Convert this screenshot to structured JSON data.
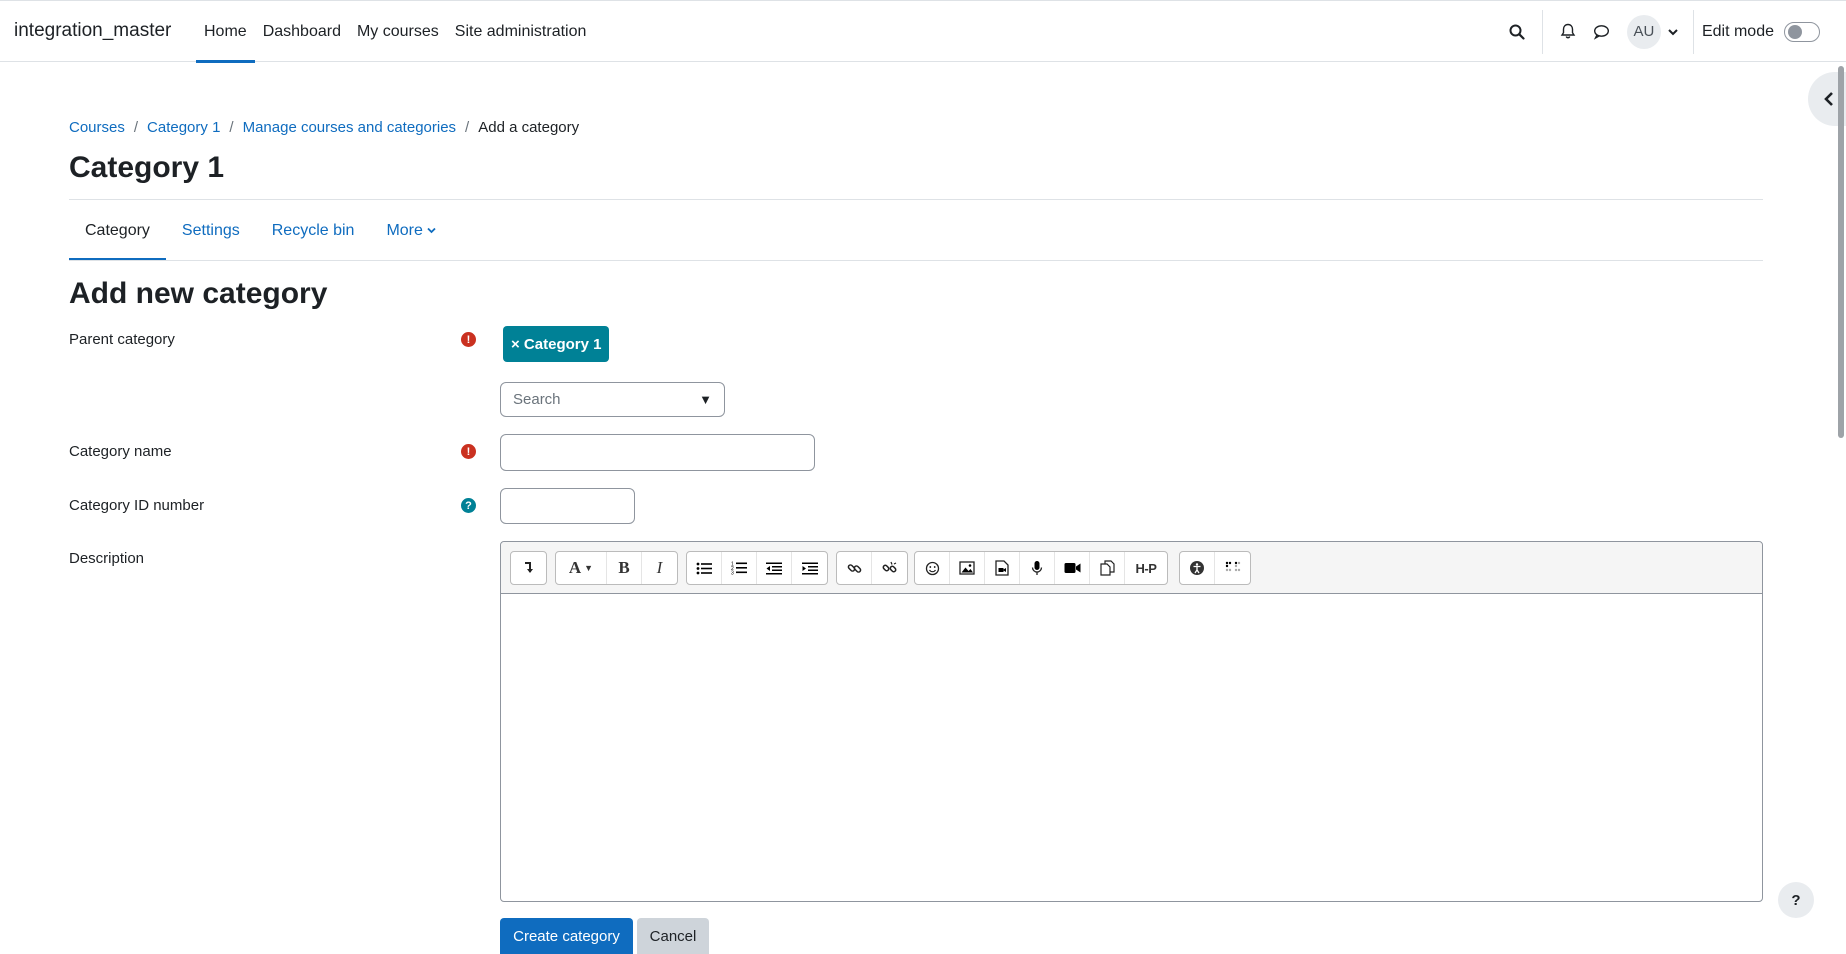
{
  "header": {
    "brand": "integration_master",
    "nav": [
      {
        "label": "Home",
        "active": true
      },
      {
        "label": "Dashboard"
      },
      {
        "label": "My courses"
      },
      {
        "label": "Site administration"
      }
    ],
    "icons": [
      "search-icon",
      "bell-icon",
      "chat-icon"
    ],
    "avatar_initials": "AU",
    "edit_mode_label": "Edit mode",
    "edit_mode_on": false
  },
  "breadcrumb": [
    "Courses",
    "Category 1",
    "Manage courses and categories",
    "Add a category"
  ],
  "page_title": "Category 1",
  "tabs": [
    {
      "label": "Category",
      "active": true
    },
    {
      "label": "Settings"
    },
    {
      "label": "Recycle bin"
    },
    {
      "label": "More"
    }
  ],
  "form": {
    "title": "Add new category",
    "parent_category": {
      "label": "Parent category",
      "selected_chip": "× Category 1",
      "search_placeholder": "Search",
      "required": true
    },
    "category_name": {
      "label": "Category name",
      "value": "",
      "required": true
    },
    "category_id": {
      "label": "Category ID number",
      "value": "",
      "help": true
    },
    "description": {
      "label": "Description",
      "value": ""
    },
    "submit_label": "Create category",
    "cancel_label": "Cancel"
  },
  "help_fab": "?",
  "colors": {
    "link": "#0f6cbf",
    "accent_teal": "#008196",
    "required_red": "#ca3120"
  }
}
